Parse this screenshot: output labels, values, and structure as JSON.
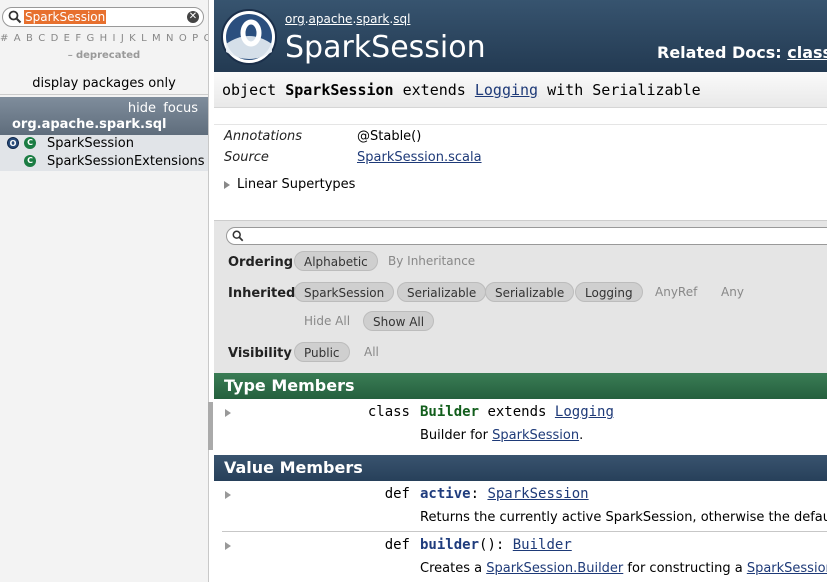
{
  "left": {
    "search_value": "SparkSession",
    "letters": "# A B C D E F G H I J K L M N O P Q R S T U V",
    "deprecated_prefix": "–",
    "deprecated_label": "deprecated",
    "display_packages": "display packages only",
    "hide": "hide",
    "focus": "focus",
    "package": "org.apache.spark.sql",
    "classes": [
      {
        "label": "SparkSession",
        "kinds": [
          "O",
          "C"
        ]
      },
      {
        "label": "SparkSessionExtensions",
        "kinds": [
          "C"
        ]
      }
    ]
  },
  "header": {
    "breadcrumb": [
      "org",
      "apache",
      "spark",
      "sql"
    ],
    "title": "SparkSession",
    "related_label": "Related Docs:",
    "related_link": "class Sp"
  },
  "signature": {
    "keyword": "object",
    "name": "SparkSession",
    "extends": "extends",
    "parent": "Logging",
    "with": "with",
    "trait": "Serializable"
  },
  "attributes": {
    "annotations_label": "Annotations",
    "annotations_value": "@Stable()",
    "source_label": "Source",
    "source_value": "SparkSession.scala",
    "linear_supertypes": "Linear Supertypes"
  },
  "filter": {
    "ordering_label": "Ordering",
    "ordering": [
      "Alphabetic",
      "By Inheritance"
    ],
    "inherited_label": "Inherited",
    "inherited": [
      "SparkSession",
      "Serializable",
      "Serializable",
      "Logging",
      "AnyRef",
      "Any"
    ],
    "hide_all": "Hide All",
    "show_all": "Show All",
    "visibility_label": "Visibility",
    "visibility": [
      "Public",
      "All"
    ]
  },
  "type_members": {
    "title": "Type Members",
    "items": [
      {
        "kw": "class",
        "name": "Builder",
        "extends": "extends",
        "parent": "Logging",
        "desc_prefix": "Builder for",
        "desc_link": "SparkSession",
        "desc_suffix": "."
      }
    ]
  },
  "value_members": {
    "title": "Value Members",
    "items": [
      {
        "kw": "def",
        "name": "active",
        "sep": ":",
        "type": "SparkSession",
        "desc": "Returns the currently active SparkSession, otherwise the default one."
      },
      {
        "kw": "def",
        "name": "builder",
        "sep": "():",
        "type": "Builder",
        "desc_prefix": "Creates a",
        "desc_link1": "SparkSession.Builder",
        "desc_middle": "for constructing a",
        "desc_link2": "SparkSession",
        "desc_suffix": "."
      }
    ]
  },
  "colors": {
    "banner": "#2c4660",
    "type_members": "#2f6e49",
    "value_members": "#304a65",
    "search_highlight": "#e7702e"
  }
}
